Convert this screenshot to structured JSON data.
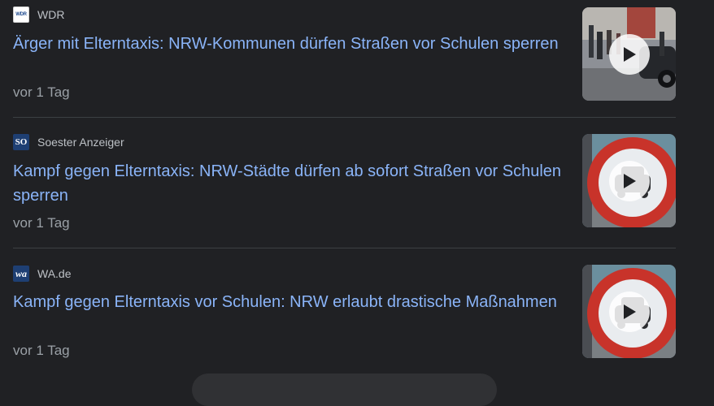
{
  "articles": [
    {
      "source": "WDR",
      "logo_text": "WDR",
      "title": "Ärger mit Elterntaxis: NRW-Kommunen dürfen Straßen vor Schulen sperren",
      "time": "vor 1 Tag",
      "thumb_icon": "play-icon"
    },
    {
      "source": "Soester Anzeiger",
      "logo_text": "SO",
      "title": "Kampf gegen Elterntaxis: NRW-Städte dürfen ab sofort Straßen vor Schulen sperren",
      "time": "vor 1 Tag",
      "thumb_icon": "play-icon"
    },
    {
      "source": "WA.de",
      "logo_text": "wa",
      "title": "Kampf gegen Elterntaxis vor Schulen: NRW erlaubt drastische Maßnahmen",
      "time": "vor 1 Tag",
      "thumb_icon": "play-icon"
    }
  ],
  "colors": {
    "background": "#202124",
    "title_link": "#8ab4f8",
    "source_text": "#bdc1c6",
    "time_text": "#9aa0a6",
    "divider": "#3c4043"
  }
}
